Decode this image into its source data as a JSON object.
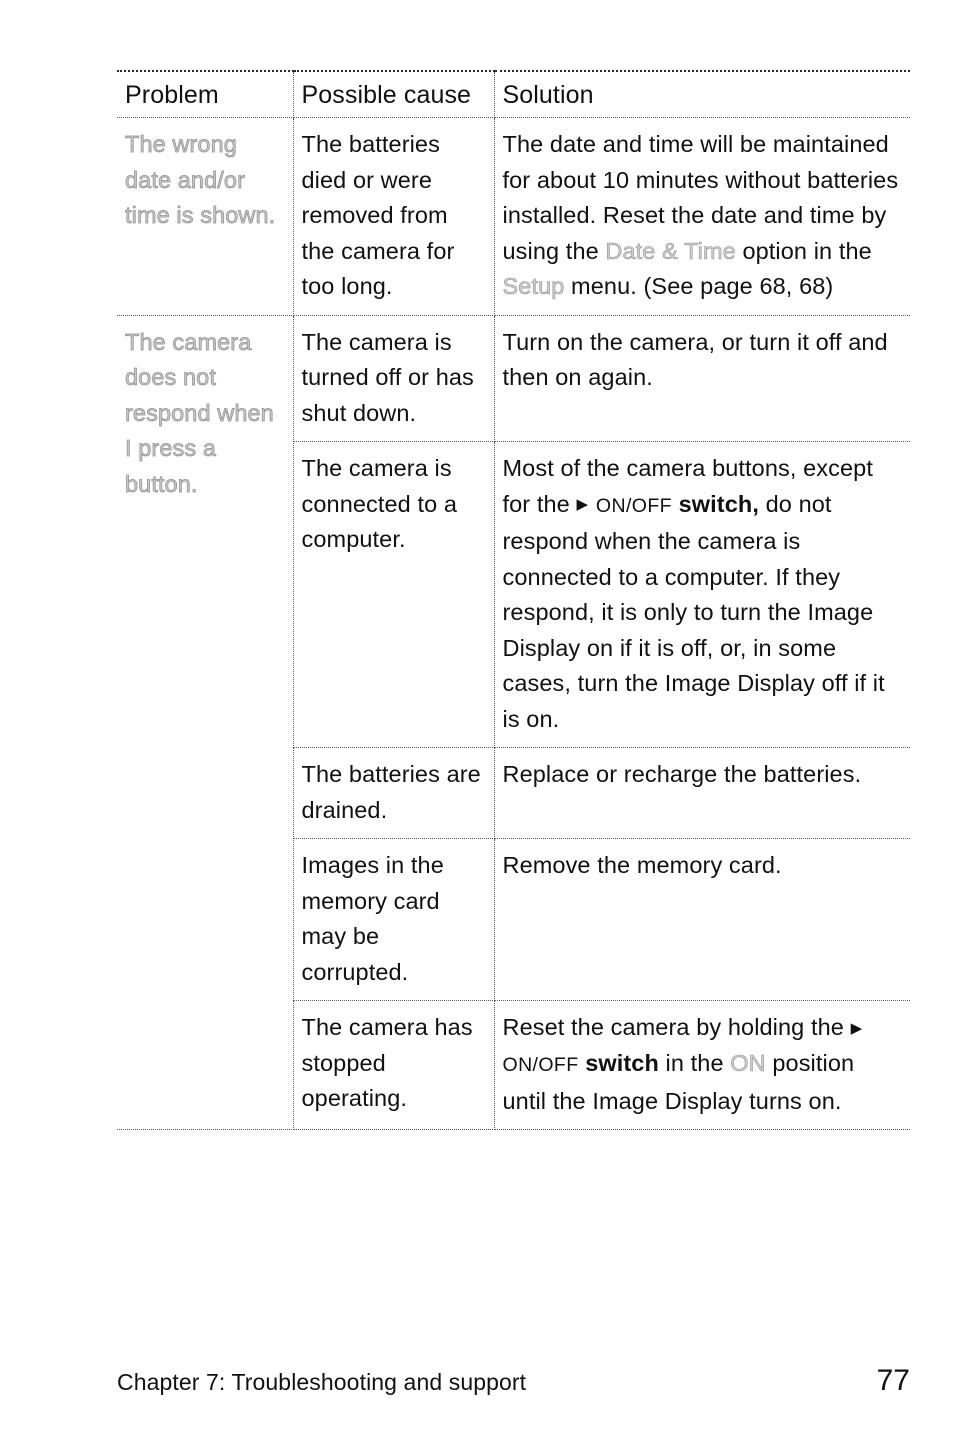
{
  "page": {
    "footer_text": "Chapter 7: Troubleshooting and support",
    "page_number": "77"
  },
  "table": {
    "headers": {
      "problem": "Problem",
      "cause": "Possible cause",
      "solution": "Solution"
    },
    "rows": [
      {
        "problem": "The wrong date and/or time is shown.",
        "problem_faded": true,
        "entries": [
          {
            "cause": "The batteries died or were removed from the camera for too long.",
            "solution_parts": [
              {
                "text": "The date and time will be maintained for about 10 minutes without batteries installed. Reset the date and time by using the ",
                "style": "normal"
              },
              {
                "text": "Date & Time",
                "style": "faded"
              },
              {
                "text": " option in the ",
                "style": "normal"
              },
              {
                "text": "Setup",
                "style": "faded"
              },
              {
                "text": " menu. (See page 68, 68)",
                "style": "normal"
              }
            ]
          }
        ]
      },
      {
        "problem": "The camera does not respond when I press a button.",
        "problem_faded": true,
        "entries": [
          {
            "cause": "The camera is turned off or has shut down.",
            "solution_parts": [
              {
                "text": "Turn on the camera, or turn it off and then on again.",
                "style": "normal"
              }
            ]
          },
          {
            "cause": "The camera is connected to a computer.",
            "solution_parts": [
              {
                "text": "Most of the camera buttons, except for the ",
                "style": "normal"
              },
              {
                "text": "▶",
                "style": "triangle"
              },
              {
                "text": " ON/OFF",
                "style": "smallcaps"
              },
              {
                "text": " switch,",
                "style": "bold"
              },
              {
                "text": " do not respond when the camera is connected to a computer. If they respond, it is only to turn the Image Display on if it is off, or, in some cases, turn the Image Display off if it is on.",
                "style": "normal"
              }
            ]
          },
          {
            "cause": "The batteries are drained.",
            "solution_parts": [
              {
                "text": "Replace or recharge the batteries.",
                "style": "normal"
              }
            ]
          },
          {
            "cause": "Images in the memory card may be corrupted.",
            "solution_parts": [
              {
                "text": "Remove the memory card.",
                "style": "normal"
              }
            ]
          },
          {
            "cause": "The camera has stopped operating.",
            "solution_parts": [
              {
                "text": "Reset the camera by holding the ",
                "style": "normal"
              },
              {
                "text": "▶",
                "style": "triangle"
              },
              {
                "text": " ON/OFF",
                "style": "smallcaps"
              },
              {
                "text": " switch",
                "style": "bold"
              },
              {
                "text": " in the ",
                "style": "normal"
              },
              {
                "text": "ON",
                "style": "faded"
              },
              {
                "text": " position until the Image Display turns on.",
                "style": "normal"
              }
            ]
          }
        ]
      }
    ]
  }
}
